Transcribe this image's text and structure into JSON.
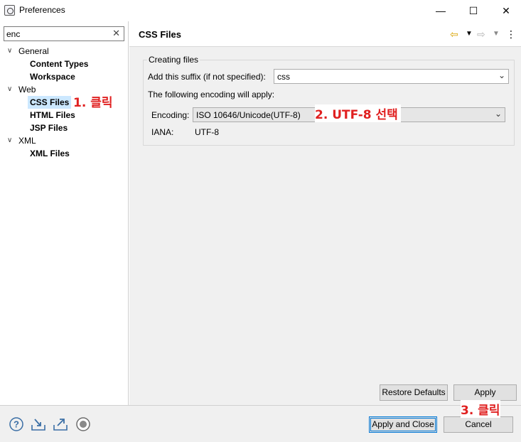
{
  "window": {
    "title": "Preferences",
    "minimize": "—",
    "maximize": "☐",
    "close": "✕"
  },
  "filter": {
    "value": "enc",
    "clear": "✕"
  },
  "tree": {
    "general": "General",
    "content_types": "Content Types",
    "workspace": "Workspace",
    "web": "Web",
    "css_files": "CSS Files",
    "html_files": "HTML Files",
    "jsp_files": "JSP Files",
    "xml": "XML",
    "xml_files": "XML Files"
  },
  "annotations": {
    "step1": "1. 클릭",
    "step2": "2. UTF-8 선택",
    "step3": "3. 클릭"
  },
  "page": {
    "title": "CSS Files",
    "group_title": "Creating files",
    "suffix_label": "Add this suffix (if not specified):",
    "suffix_value": "css",
    "encoding_info": "The following encoding will apply:",
    "encoding_label": "Encoding:",
    "encoding_value": "ISO 10646/Unicode(UTF-8)",
    "iana_label": "IANA:",
    "iana_value": "UTF-8"
  },
  "buttons": {
    "restore_defaults": "Restore Defaults",
    "apply": "Apply",
    "apply_and_close": "Apply and Close",
    "cancel": "Cancel"
  },
  "icons": {
    "help": "help-icon",
    "import": "import-icon",
    "export": "export-icon",
    "record": "record-icon",
    "back": "back-arrow-icon",
    "forward": "forward-arrow-icon",
    "menu": "view-menu-icon"
  },
  "colors": {
    "annotation": "#e02020",
    "selection": "#cce8ff",
    "default_button_border": "#0078d7"
  }
}
